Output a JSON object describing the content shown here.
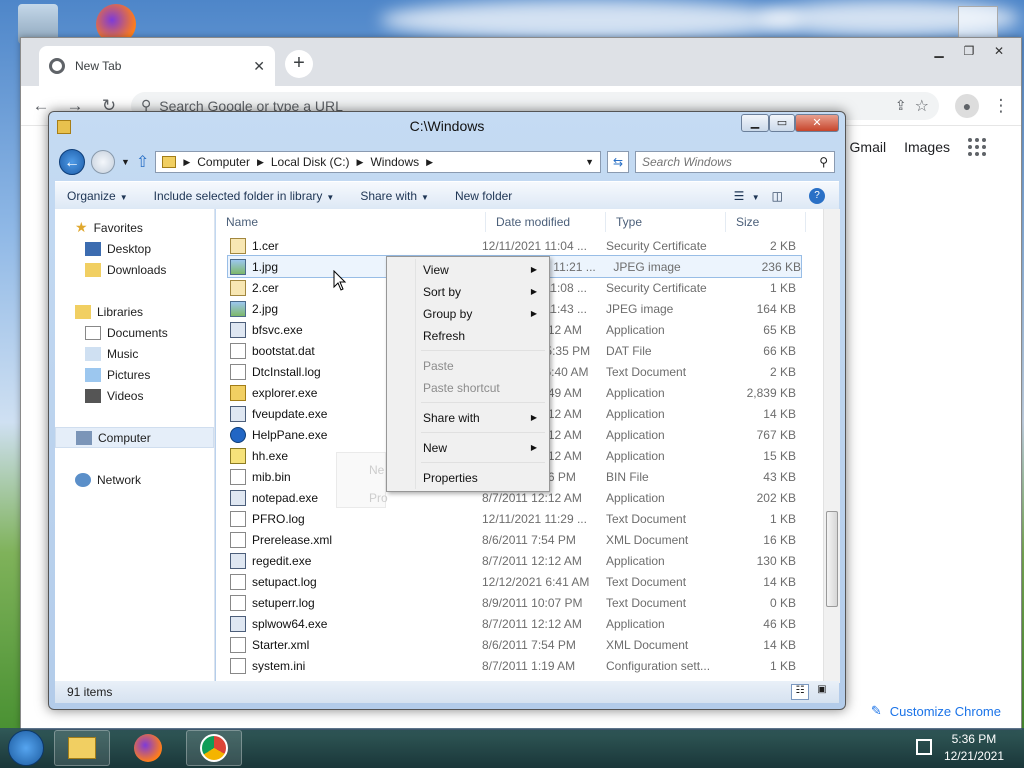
{
  "chrome": {
    "tab_title": "New Tab",
    "omnibox_placeholder": "Search Google or type a URL",
    "gmail": "Gmail",
    "images": "Images",
    "customize": "Customize Chrome"
  },
  "explorer": {
    "title": "C:\\Windows",
    "breadcrumb": [
      "Computer",
      "Local Disk (C:)",
      "Windows"
    ],
    "search_placeholder": "Search Windows",
    "commands": [
      "Organize",
      "Include selected folder in library",
      "Share with",
      "New folder"
    ],
    "nav": {
      "favorites": "Favorites",
      "favorites_items": [
        "Desktop",
        "Downloads"
      ],
      "libraries": "Libraries",
      "libraries_items": [
        "Documents",
        "Music",
        "Pictures",
        "Videos"
      ],
      "computer": "Computer",
      "network": "Network"
    },
    "columns": {
      "name": "Name",
      "date": "Date modified",
      "type": "Type",
      "size": "Size"
    },
    "files": [
      {
        "name": "1.cer",
        "date": "12/11/2021 11:04 ...",
        "type": "Security Certificate",
        "size": "2 KB",
        "icon": "cer"
      },
      {
        "name": "1.jpg",
        "date": "12/11/2021 11:21 ...",
        "type": "JPEG image",
        "size": "236 KB",
        "icon": "img"
      },
      {
        "name": "2.cer",
        "date": "12/11/2021 11:08 ...",
        "type": "Security Certificate",
        "size": "1 KB",
        "icon": "cer"
      },
      {
        "name": "2.jpg",
        "date": "12/11/2021 11:43 ...",
        "type": "JPEG image",
        "size": "164 KB",
        "icon": "img"
      },
      {
        "name": "bfsvc.exe",
        "date": "8/7/2011 12:12 AM",
        "type": "Application",
        "size": "65 KB",
        "icon": "exe"
      },
      {
        "name": "bootstat.dat",
        "date": "12/21/2021 5:35 PM",
        "type": "DAT File",
        "size": "66 KB",
        "icon": "txt"
      },
      {
        "name": "DtcInstall.log",
        "date": "12/11/2021 6:40 AM",
        "type": "Text Document",
        "size": "2 KB",
        "icon": "txt"
      },
      {
        "name": "explorer.exe",
        "date": "8/7/2011 12:49 AM",
        "type": "Application",
        "size": "2,839 KB",
        "icon": "folder"
      },
      {
        "name": "fveupdate.exe",
        "date": "8/7/2011 12:12 AM",
        "type": "Application",
        "size": "14 KB",
        "icon": "exe"
      },
      {
        "name": "HelpPane.exe",
        "date": "8/7/2011 12:12 AM",
        "type": "Application",
        "size": "767 KB",
        "icon": "help"
      },
      {
        "name": "hh.exe",
        "date": "8/7/2011 12:12 AM",
        "type": "Application",
        "size": "15 KB",
        "icon": "hh"
      },
      {
        "name": "mib.bin",
        "date": "8/7/2011 1:46 PM",
        "type": "BIN File",
        "size": "43 KB",
        "icon": "txt"
      },
      {
        "name": "notepad.exe",
        "date": "8/7/2011 12:12 AM",
        "type": "Application",
        "size": "202 KB",
        "icon": "exe"
      },
      {
        "name": "PFRO.log",
        "date": "12/11/2021 11:29 ...",
        "type": "Text Document",
        "size": "1 KB",
        "icon": "txt"
      },
      {
        "name": "Prerelease.xml",
        "date": "8/6/2011 7:54 PM",
        "type": "XML Document",
        "size": "16 KB",
        "icon": "txt"
      },
      {
        "name": "regedit.exe",
        "date": "8/7/2011 12:12 AM",
        "type": "Application",
        "size": "130 KB",
        "icon": "exe"
      },
      {
        "name": "setupact.log",
        "date": "12/12/2021 6:41 AM",
        "type": "Text Document",
        "size": "14 KB",
        "icon": "txt"
      },
      {
        "name": "setuperr.log",
        "date": "8/9/2011 10:07 PM",
        "type": "Text Document",
        "size": "0 KB",
        "icon": "txt"
      },
      {
        "name": "splwow64.exe",
        "date": "8/7/2011 12:12 AM",
        "type": "Application",
        "size": "46 KB",
        "icon": "exe"
      },
      {
        "name": "Starter.xml",
        "date": "8/6/2011 7:54 PM",
        "type": "XML Document",
        "size": "14 KB",
        "icon": "txt"
      },
      {
        "name": "system.ini",
        "date": "8/7/2011 1:19 AM",
        "type": "Configuration sett...",
        "size": "1 KB",
        "icon": "txt"
      }
    ],
    "selected_index": 1,
    "status": "91 items"
  },
  "context_menu": {
    "items": [
      {
        "label": "View",
        "submenu": true,
        "disabled": false
      },
      {
        "label": "Sort by",
        "submenu": true,
        "disabled": false
      },
      {
        "label": "Group by",
        "submenu": true,
        "disabled": false
      },
      {
        "label": "Refresh",
        "submenu": false,
        "disabled": false
      },
      {
        "sep": true
      },
      {
        "label": "Paste",
        "submenu": false,
        "disabled": true
      },
      {
        "label": "Paste shortcut",
        "submenu": false,
        "disabled": true
      },
      {
        "sep": true
      },
      {
        "label": "Share with",
        "submenu": true,
        "disabled": false
      },
      {
        "sep": true
      },
      {
        "label": "New",
        "submenu": true,
        "disabled": false
      },
      {
        "sep": true
      },
      {
        "label": "Properties",
        "submenu": false,
        "disabled": false
      }
    ],
    "ghost_items": [
      "Ne",
      "Pro"
    ]
  },
  "taskbar": {
    "time": "5:36 PM",
    "date": "12/21/2021"
  }
}
